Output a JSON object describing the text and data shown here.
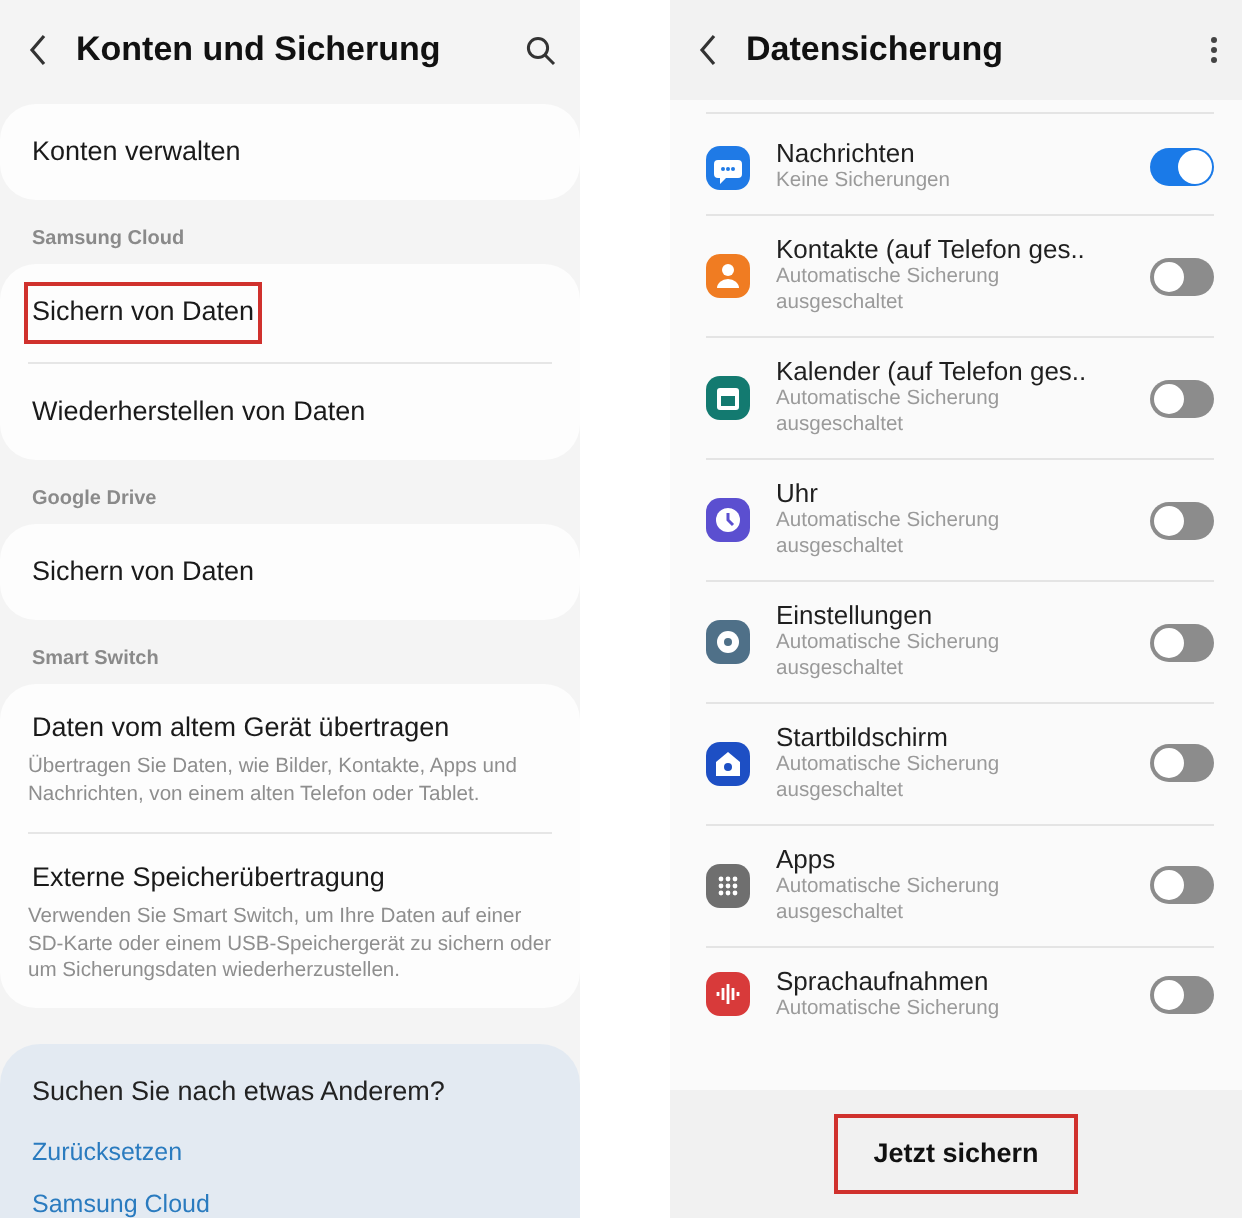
{
  "left_screen": {
    "title": "Konten und Sicherung",
    "groups": [
      {
        "items": [
          {
            "title": "Konten verwalten",
            "highlighted": false
          }
        ]
      },
      {
        "label": "Samsung Cloud",
        "items": [
          {
            "title": "Sichern von Daten",
            "highlighted": true
          },
          {
            "title": "Wiederherstellen von Daten",
            "highlighted": false
          }
        ]
      },
      {
        "label": "Google Drive",
        "items": [
          {
            "title": "Sichern von Daten",
            "highlighted": false
          }
        ]
      },
      {
        "label": "Smart Switch",
        "items": [
          {
            "title": "Daten vom altem Gerät übertragen",
            "description": "Übertragen Sie Daten, wie Bilder, Kontakte, Apps und Nachrichten, von einem alten Telefon oder Tablet.",
            "highlighted": false
          },
          {
            "title": "Externe Speicherübertragung",
            "description": "Verwenden Sie Smart Switch, um Ihre Daten auf einer SD-Karte oder einem USB-Speichergerät zu sichern oder um Sicherungsdaten wiederherzustellen.",
            "highlighted": false
          }
        ]
      }
    ],
    "suggestions": {
      "title": "Suchen Sie nach etwas Anderem?",
      "links": [
        "Zurücksetzen",
        "Samsung Cloud"
      ]
    }
  },
  "right_screen": {
    "title": "Datensicherung",
    "rows": [
      {
        "title": "Nachrichten",
        "subtitle": "Keine Sicherungen",
        "color": "#1f7ae6",
        "on": true
      },
      {
        "title": "Kontakte (auf Telefon ges..",
        "subtitle": "Automatische Sicherung ausgeschaltet",
        "color": "#f07c22",
        "on": false
      },
      {
        "title": "Kalender (auf Telefon ges..",
        "subtitle": "Automatische Sicherung ausgeschaltet",
        "color": "#137a70",
        "on": false
      },
      {
        "title": "Uhr",
        "subtitle": "Automatische Sicherung ausgeschaltet",
        "color": "#5b4fd0",
        "on": false
      },
      {
        "title": "Einstellungen",
        "subtitle": "Automatische Sicherung ausgeschaltet",
        "color": "#4f7088",
        "on": false
      },
      {
        "title": "Startbildschirm",
        "subtitle": "Automatische Sicherung ausgeschaltet",
        "color": "#1d4fc4",
        "on": false
      },
      {
        "title": "Apps",
        "subtitle": "Automatische Sicherung ausgeschaltet",
        "color": "#6f6f6f",
        "on": false
      },
      {
        "title": "Sprachaufnahmen",
        "subtitle": "Automatische Sicherung",
        "color": "#d83a3a",
        "on": false
      }
    ],
    "button": {
      "label": "Jetzt sichern",
      "highlighted": true
    }
  }
}
